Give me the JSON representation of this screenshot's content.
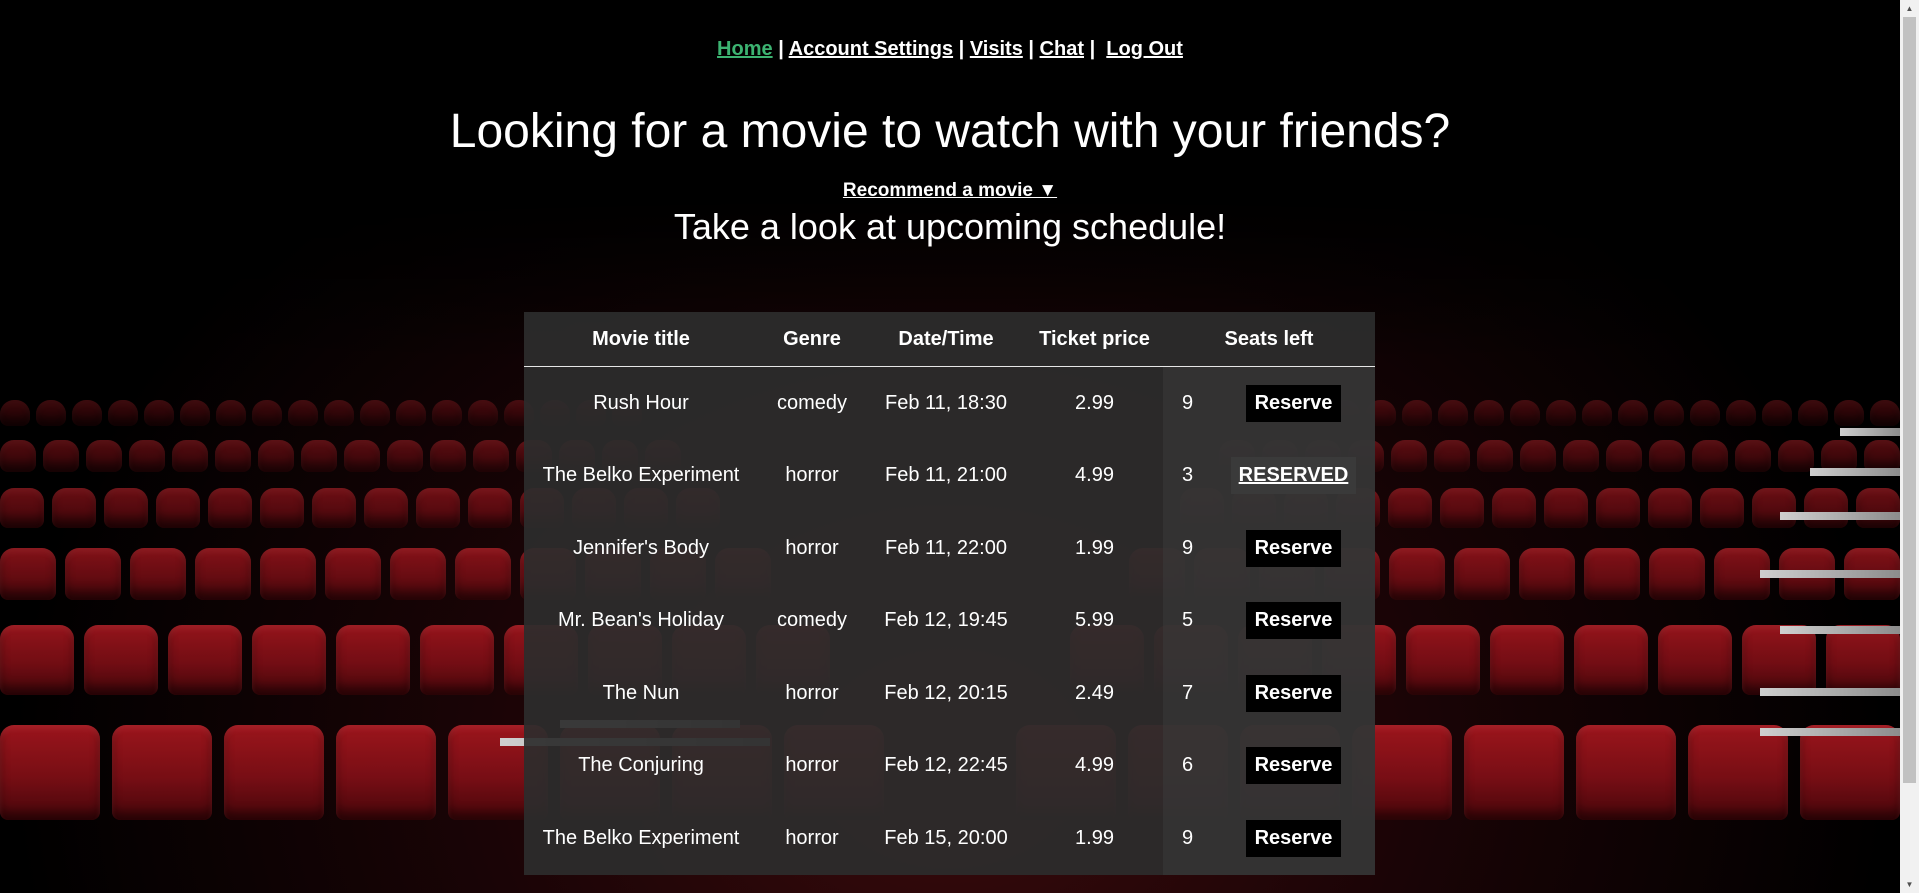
{
  "nav": {
    "home": "Home",
    "account_settings": "Account Settings",
    "visits": "Visits",
    "chat": "Chat",
    "log_out": "Log Out",
    "separator": "|"
  },
  "headline": "Looking for a movie to watch with your friends?",
  "recommend_label": "Recommend a movie ▼",
  "subheadline": "Take a look at upcoming schedule!",
  "table": {
    "headers": {
      "title": "Movie title",
      "genre": "Genre",
      "datetime": "Date/Time",
      "price": "Ticket price",
      "seats": "Seats left"
    },
    "rows": [
      {
        "title": "Rush Hour",
        "genre": "comedy",
        "datetime": "Feb 11, 18:30",
        "price": "2.99",
        "seats": "9",
        "action": "Reserve",
        "reserved": false
      },
      {
        "title": "The Belko Experiment",
        "genre": "horror",
        "datetime": "Feb 11, 21:00",
        "price": "4.99",
        "seats": "3",
        "action": "RESERVED",
        "reserved": true
      },
      {
        "title": "Jennifer's Body",
        "genre": "horror",
        "datetime": "Feb 11, 22:00",
        "price": "1.99",
        "seats": "9",
        "action": "Reserve",
        "reserved": false
      },
      {
        "title": "Mr. Bean's Holiday",
        "genre": "comedy",
        "datetime": "Feb 12, 19:45",
        "price": "5.99",
        "seats": "5",
        "action": "Reserve",
        "reserved": false
      },
      {
        "title": "The Nun",
        "genre": "horror",
        "datetime": "Feb 12, 20:15",
        "price": "2.49",
        "seats": "7",
        "action": "Reserve",
        "reserved": false
      },
      {
        "title": "The Conjuring",
        "genre": "horror",
        "datetime": "Feb 12, 22:45",
        "price": "4.99",
        "seats": "6",
        "action": "Reserve",
        "reserved": false
      },
      {
        "title": "The Belko Experiment",
        "genre": "horror",
        "datetime": "Feb 15, 20:00",
        "price": "1.99",
        "seats": "9",
        "action": "Reserve",
        "reserved": false
      }
    ]
  },
  "colors": {
    "active_link": "#3cb371",
    "seat_red": "#8e121a",
    "table_bg": "#2c2c2c"
  }
}
